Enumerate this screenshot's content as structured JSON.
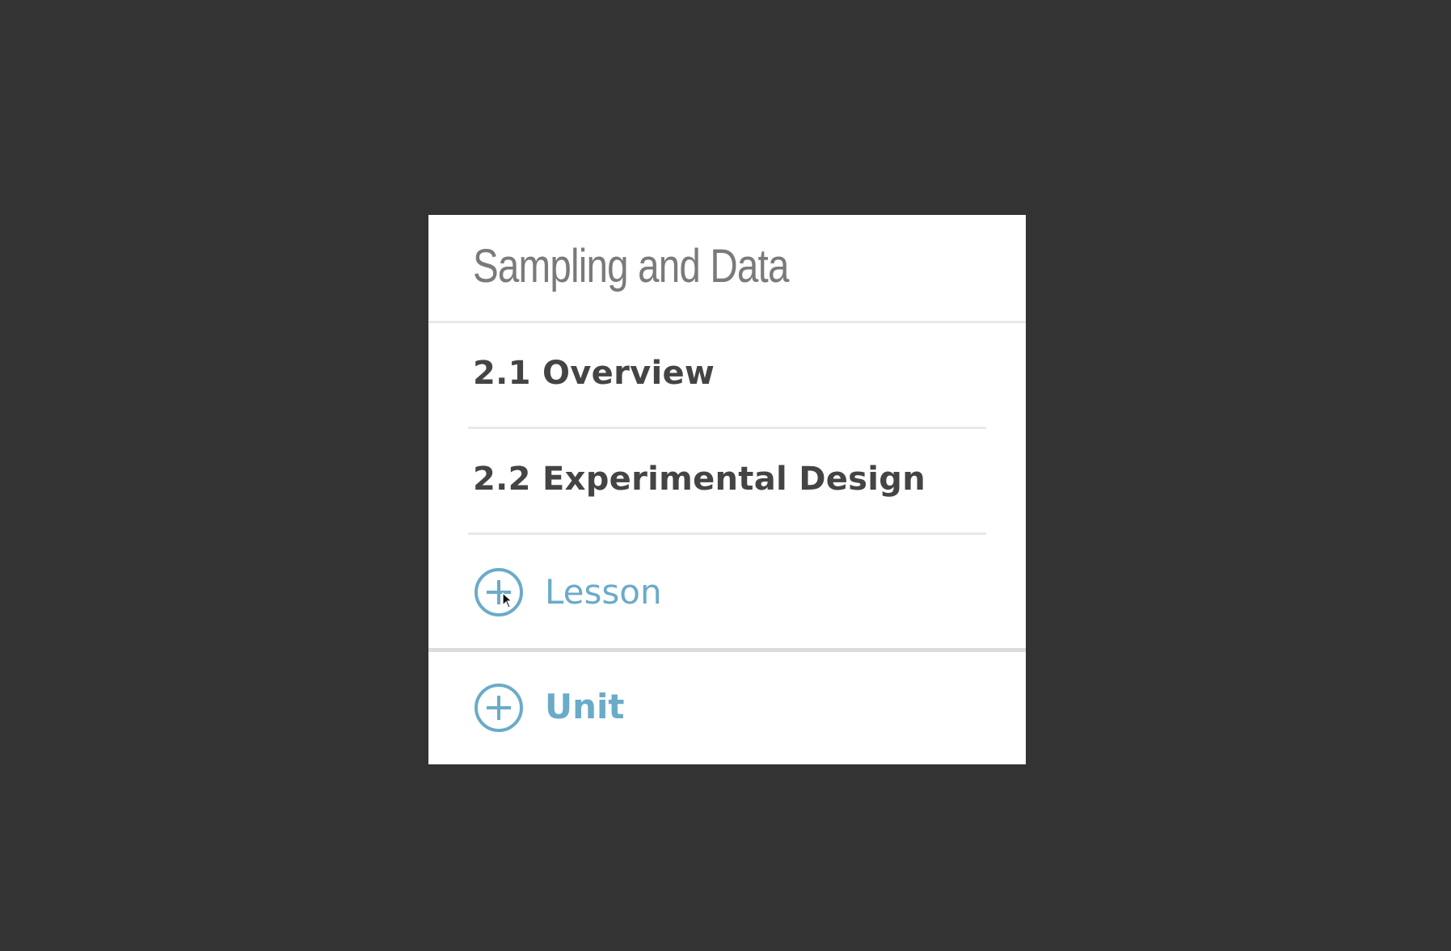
{
  "card": {
    "title": "Sampling and Data",
    "lessons": [
      {
        "label": "2.1 Overview"
      },
      {
        "label": "2.2 Experimental Design"
      }
    ],
    "add_lesson_label": "Lesson",
    "add_unit_label": "Unit"
  },
  "colors": {
    "background": "#333333",
    "card": "#ffffff",
    "title": "#7a7a7a",
    "lesson_text": "#444444",
    "accent": "#6aabc9",
    "divider": "#e8e8e8"
  },
  "icons": {
    "add_lesson": "plus-circle-icon",
    "add_unit": "plus-circle-icon",
    "cursor": "mouse-pointer-icon"
  }
}
